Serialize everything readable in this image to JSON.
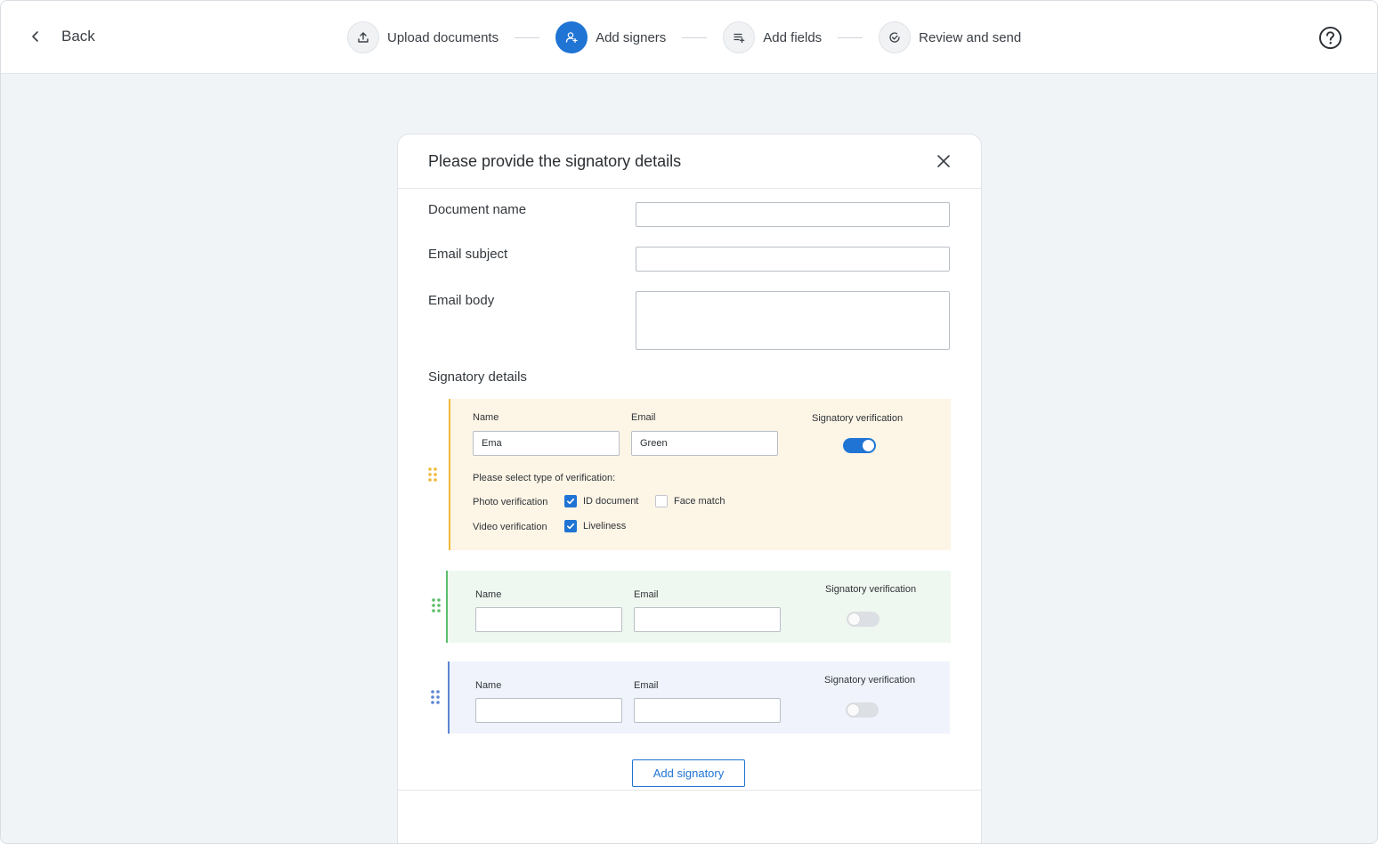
{
  "header": {
    "back_label": "Back",
    "steps": [
      {
        "label": "Upload documents",
        "icon": "upload-icon",
        "active": false
      },
      {
        "label": "Add signers",
        "icon": "user-add-icon",
        "active": true
      },
      {
        "label": "Add fields",
        "icon": "list-add-icon",
        "active": false
      },
      {
        "label": "Review and send",
        "icon": "check-circle-icon",
        "active": false
      }
    ],
    "help_icon": "help-icon"
  },
  "colors": {
    "accent": "#1f74d4",
    "signer_1": "#f0b93a",
    "signer_2": "#5bbd6a",
    "signer_3": "#5d86d1"
  },
  "modal": {
    "title": "Please provide the signatory details",
    "fields": {
      "document_name": {
        "label": "Document name",
        "value": ""
      },
      "email_subject": {
        "label": "Email subject",
        "value": ""
      },
      "email_body": {
        "label": "Email body",
        "value": ""
      }
    },
    "signatory_section_title": "Signatory details",
    "signatories": [
      {
        "name_label": "Name",
        "name_value": "Ema",
        "email_label": "Email",
        "email_value": "Green",
        "verification_label": "Signatory verification",
        "verification_enabled": true,
        "verification_prompt": "Please select type of verification:",
        "photo_label": "Photo verification",
        "id_document_label": "ID document",
        "id_document_checked": true,
        "face_match_label": "Face match",
        "face_match_checked": false,
        "video_label": "Video verification",
        "liveliness_label": "Liveliness",
        "liveliness_checked": true
      },
      {
        "name_label": "Name",
        "name_value": "",
        "email_label": "Email",
        "email_value": "",
        "verification_label": "Signatory verification",
        "verification_enabled": false
      },
      {
        "name_label": "Name",
        "name_value": "",
        "email_label": "Email",
        "email_value": "",
        "verification_label": "Signatory verification",
        "verification_enabled": false
      }
    ],
    "add_signatory_label": "Add signatory"
  }
}
